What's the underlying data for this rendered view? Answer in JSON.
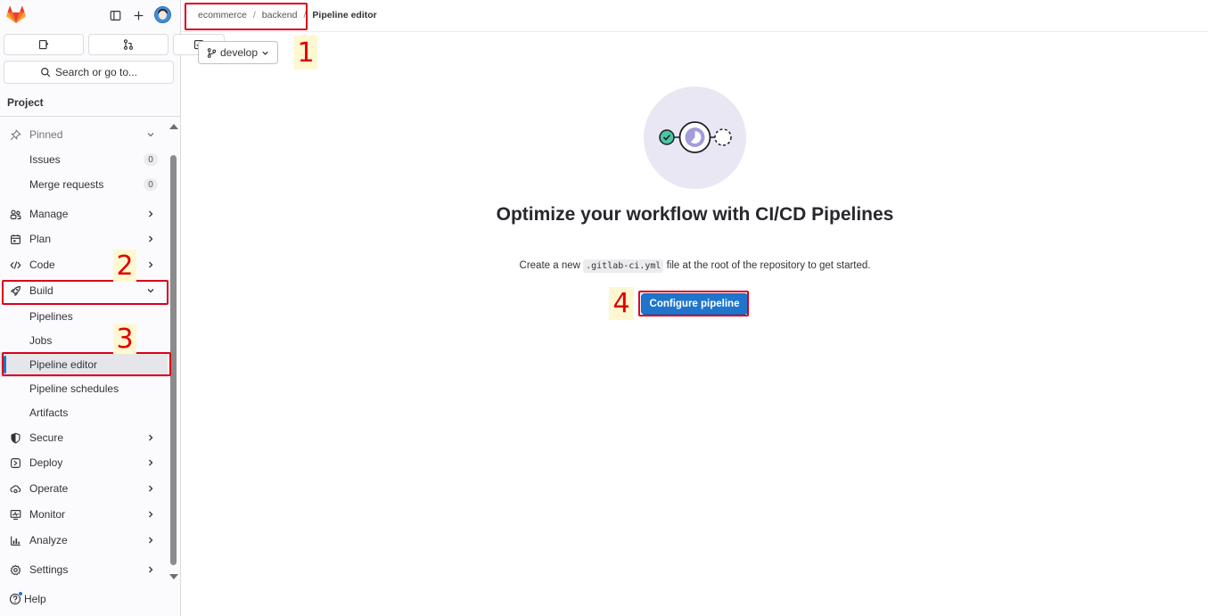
{
  "sidebar": {
    "quick_actions": [
      "issues-icon",
      "merge-requests-icon",
      "todos-icon"
    ],
    "search_label": "Search or go to...",
    "section_title": "Project",
    "pinned": {
      "label": "Pinned",
      "items": [
        {
          "label": "Issues",
          "count": "0"
        },
        {
          "label": "Merge requests",
          "count": "0"
        }
      ]
    },
    "nav": {
      "manage": "Manage",
      "plan": "Plan",
      "code": "Code",
      "build": "Build",
      "build_items": [
        "Pipelines",
        "Jobs",
        "Pipeline editor",
        "Pipeline schedules",
        "Artifacts"
      ],
      "secure": "Secure",
      "deploy": "Deploy",
      "operate": "Operate",
      "monitor": "Monitor",
      "analyze": "Analyze",
      "settings": "Settings"
    },
    "help_label": "Help",
    "active_item": "Pipeline editor"
  },
  "breadcrumb": {
    "items": [
      "ecommerce",
      "backend"
    ],
    "separator": "/",
    "current": "Pipeline editor"
  },
  "branch": {
    "label": "develop"
  },
  "empty_state": {
    "title": "Optimize your workflow with CI/CD Pipelines",
    "desc_before": "Create a new",
    "code": ".gitlab-ci.yml",
    "desc_after": "file at the root of the repository to get started.",
    "button": "Configure pipeline"
  },
  "annotations": [
    "1",
    "2",
    "3",
    "4"
  ],
  "colors": {
    "accent": "#1f75cb",
    "annotation": "#d9001b",
    "illustration_bg": "#e9e7f4"
  }
}
